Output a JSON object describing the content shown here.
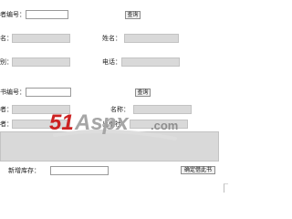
{
  "section1": {
    "reader_id_label": "者编号：",
    "query_button": "查询",
    "row2_left_label": "名：",
    "name_label": "姓名：",
    "row3_left_label": "别：",
    "phone_label": "电话："
  },
  "section2": {
    "book_id_label": "书编号：",
    "query_button": "查询",
    "row2_left_label": "者：",
    "title_label": "名称：",
    "row3_left_label": "者：",
    "row3_right_label": "出版社："
  },
  "footer": {
    "copies_label": "新增库存：",
    "confirm_button": "确定借此书"
  },
  "watermark": {
    "brand": "51Aspx",
    "suffix": ".com",
    "colors": {
      "five_one": "#cc2222",
      "aspx": "#a6a6a6",
      "com": "#8e8e8e",
      "swoosh": "#dddddd"
    }
  }
}
